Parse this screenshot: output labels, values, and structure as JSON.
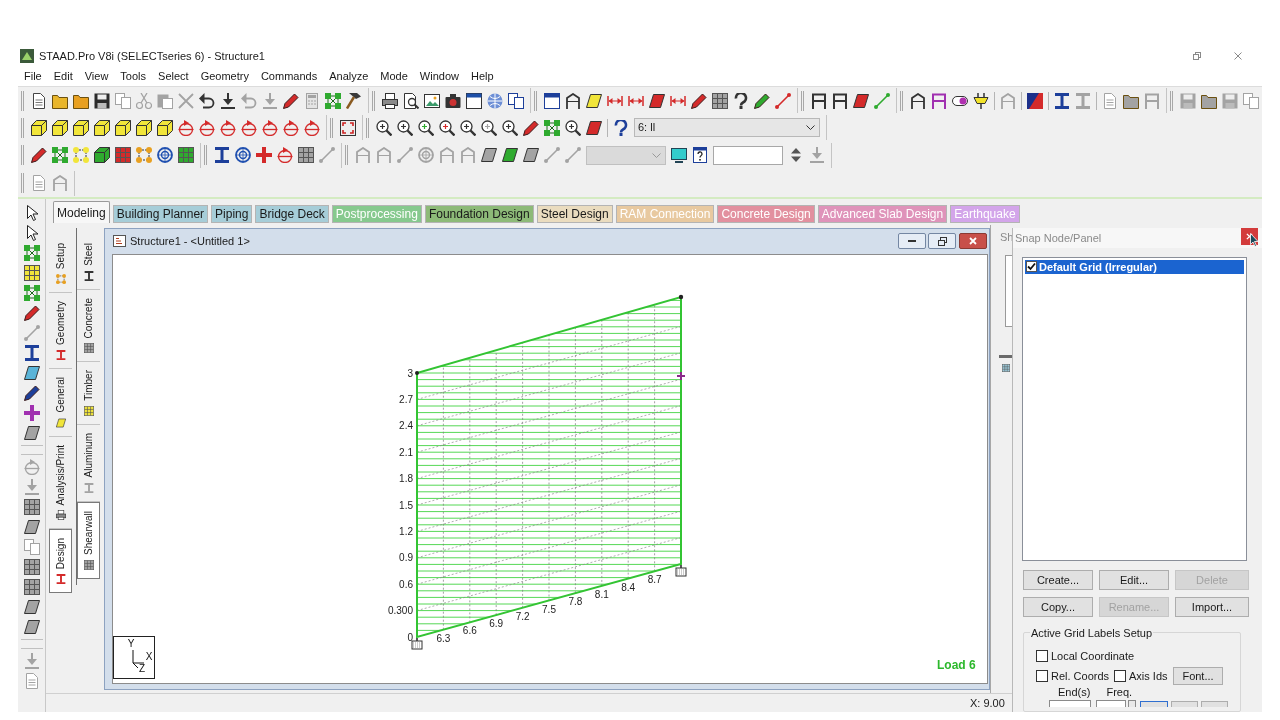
{
  "window": {
    "title": "STAAD.Pro V8i (SELECTseries 6) - Structure1"
  },
  "menu": [
    "File",
    "Edit",
    "View",
    "Tools",
    "Select",
    "Geometry",
    "Commands",
    "Analyze",
    "Mode",
    "Window",
    "Help"
  ],
  "toolbar": {
    "load_case": "6: ll"
  },
  "page_tabs": [
    {
      "label": "Modeling",
      "selected": true,
      "disabled": false,
      "color": "#f7f7f7"
    },
    {
      "label": "Building Planner",
      "selected": false,
      "disabled": false,
      "color": "#a6cdd8"
    },
    {
      "label": "Piping",
      "selected": false,
      "disabled": false,
      "color": "#a6cdd8"
    },
    {
      "label": "Bridge Deck",
      "selected": false,
      "disabled": false,
      "color": "#a6cdd8"
    },
    {
      "label": "Postprocessing",
      "selected": false,
      "disabled": true,
      "color": "#86c98e"
    },
    {
      "label": "Foundation Design",
      "selected": false,
      "disabled": false,
      "color": "#8dba78"
    },
    {
      "label": "Steel Design",
      "selected": false,
      "disabled": false,
      "color": "#eadcbf"
    },
    {
      "label": "RAM Connection",
      "selected": false,
      "disabled": true,
      "color": "#e8c9a0"
    },
    {
      "label": "Concrete Design",
      "selected": false,
      "disabled": true,
      "color": "#e2909f"
    },
    {
      "label": "Advanced Slab Design",
      "selected": false,
      "disabled": true,
      "color": "#df93ba"
    },
    {
      "label": "Earthquake",
      "selected": false,
      "disabled": true,
      "color": "#d3a5ea"
    }
  ],
  "side_tabs": [
    {
      "label": "Setup",
      "selected": false
    },
    {
      "label": "Geometry",
      "selected": false
    },
    {
      "label": "General",
      "selected": false
    },
    {
      "label": "Analysis/Print",
      "selected": false
    },
    {
      "label": "Design",
      "selected": true
    }
  ],
  "design_tabs": [
    {
      "label": "Steel",
      "selected": false
    },
    {
      "label": "Concrete",
      "selected": false
    },
    {
      "label": "Timber",
      "selected": false
    },
    {
      "label": "Aluminum",
      "selected": false
    },
    {
      "label": "Shearwall",
      "selected": true
    }
  ],
  "document": {
    "title": "Structure1 - <Untitled 1>",
    "y_labels": [
      "3",
      "2.7",
      "2.4",
      "2.1",
      "1.8",
      "1.5",
      "1.2",
      "0.9",
      "0.6",
      "0.300",
      "0"
    ],
    "x_labels": [
      "6.3",
      "6.6",
      "6.9",
      "7.2",
      "7.5",
      "7.8",
      "8.1",
      "8.4",
      "8.7"
    ],
    "axes": [
      "Y",
      "X",
      "Z"
    ],
    "load_label": "Load 6"
  },
  "side_panel": {
    "title": "Sh"
  },
  "snap_panel": {
    "title": "Snap Node/Panel",
    "grids": [
      {
        "label": "Default Grid (Irregular)",
        "checked": true,
        "selected": true
      }
    ],
    "buttons": [
      {
        "label": "Create...",
        "disabled": false
      },
      {
        "label": "Edit...",
        "disabled": false
      },
      {
        "label": "Delete",
        "disabled": true
      },
      {
        "label": "Copy...",
        "disabled": false
      },
      {
        "label": "Rename...",
        "disabled": true
      },
      {
        "label": "Import...",
        "disabled": false
      }
    ],
    "labels_setup": {
      "title": "Active Grid Labels Setup",
      "options": [
        {
          "label": "Local Coordinate",
          "checked": false
        },
        {
          "label": "Rel. Coords",
          "checked": false
        },
        {
          "label": "Axis Ids",
          "checked": false
        }
      ],
      "font_button": "Font...",
      "fields": [
        "End(s)",
        "Freq."
      ]
    }
  },
  "status_bar": {
    "coordinate": "X: 9.00"
  }
}
